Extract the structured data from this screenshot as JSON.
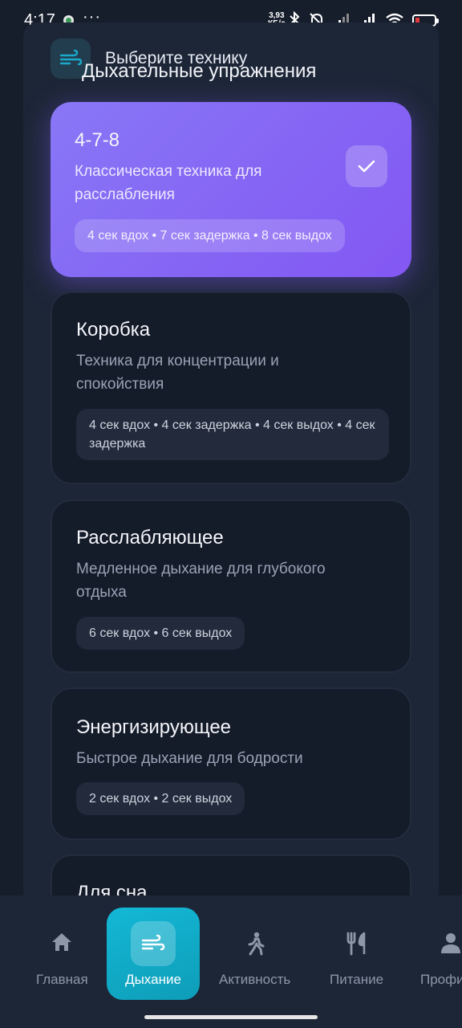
{
  "status_bar": {
    "time": "4:17",
    "more": "···",
    "speed_value": "3,93",
    "speed_unit": "КБ/с"
  },
  "header": {
    "subtitle": "Выберите технику",
    "title": "Дыхательные упражнения",
    "icon": "wind-icon"
  },
  "techniques": [
    {
      "title": "4-7-8",
      "description": "Классическая техника для расслабления",
      "pattern": "4 сек вдох • 7 сек задержка • 8 сек выдох",
      "selected": true
    },
    {
      "title": "Коробка",
      "description": "Техника для концентрации и спокойствия",
      "pattern": "4 сек вдох • 4 сек задержка • 4 сек выдох • 4 сек задержка",
      "selected": false
    },
    {
      "title": "Расслабляющее",
      "description": "Медленное дыхание для глубокого отдыха",
      "pattern": "6 сек вдох • 6 сек выдох",
      "selected": false
    },
    {
      "title": "Энергизирующее",
      "description": "Быстрое дыхание для бодрости",
      "pattern": "2 сек вдох • 2 сек выдох",
      "selected": false
    },
    {
      "title": "Для сна",
      "selected": false
    }
  ],
  "nav": [
    {
      "label": "Главная",
      "icon": "home-icon",
      "active": false
    },
    {
      "label": "Дыхание",
      "icon": "wind-icon",
      "active": true
    },
    {
      "label": "Активность",
      "icon": "walking-icon",
      "active": false
    },
    {
      "label": "Питание",
      "icon": "utensils-icon",
      "active": false
    },
    {
      "label": "Профиль",
      "icon": "user-icon",
      "active": false
    }
  ],
  "colors": {
    "accent_purple": "#8566f4",
    "accent_cyan": "#13b8d6",
    "background": "#161d2b"
  }
}
